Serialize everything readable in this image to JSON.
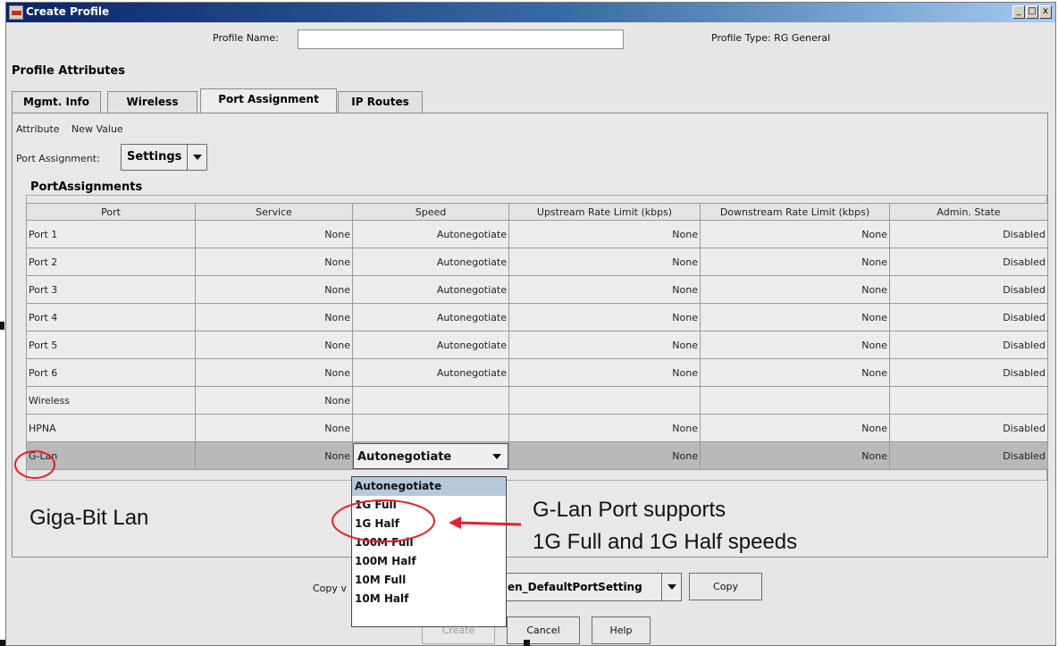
{
  "window": {
    "title": "Create Profile",
    "controls": {
      "minimize": "_",
      "maximize": "□",
      "close": "x"
    }
  },
  "header": {
    "profile_name_label": "Profile Name:",
    "profile_name_value": "",
    "profile_type": "Profile Type: RG General"
  },
  "section_title": "Profile Attributes",
  "tabs": [
    {
      "label": "Mgmt. Info",
      "active": false
    },
    {
      "label": "Wireless",
      "active": false
    },
    {
      "label": "Port Assignment",
      "active": true
    },
    {
      "label": "IP Routes",
      "active": false
    }
  ],
  "attributes": {
    "attribute_label": "Attribute",
    "new_value_label": "New Value",
    "port_assignment_label": "Port Assignment:",
    "port_assignment_value": "Settings"
  },
  "port_assignments": {
    "title": "PortAssignments",
    "columns": [
      "Port",
      "Service",
      "Speed",
      "Upstream Rate Limit (kbps)",
      "Downstream Rate Limit (kbps)",
      "Admin. State"
    ],
    "rows": [
      [
        "Port 1",
        "None",
        "Autonegotiate",
        "None",
        "None",
        "Disabled"
      ],
      [
        "Port 2",
        "None",
        "Autonegotiate",
        "None",
        "None",
        "Disabled"
      ],
      [
        "Port 3",
        "None",
        "Autonegotiate",
        "None",
        "None",
        "Disabled"
      ],
      [
        "Port 4",
        "None",
        "Autonegotiate",
        "None",
        "None",
        "Disabled"
      ],
      [
        "Port 5",
        "None",
        "Autonegotiate",
        "None",
        "None",
        "Disabled"
      ],
      [
        "Port 6",
        "None",
        "Autonegotiate",
        "None",
        "None",
        "Disabled"
      ],
      [
        "Wireless",
        "None",
        "",
        "",
        "",
        ""
      ],
      [
        "HPNA",
        "None",
        "",
        "None",
        "None",
        "Disabled"
      ],
      [
        "G-Lan",
        "None",
        "Autonegotiate",
        "None",
        "None",
        "Disabled"
      ]
    ],
    "selected_row": 8
  },
  "speed_dropdown": {
    "options": [
      "Autonegotiate",
      "1G Full",
      "1G Half",
      "100M Full",
      "100M Half",
      "10M Full",
      "10M Half"
    ],
    "highlighted": "Autonegotiate"
  },
  "annotations": {
    "giga_label": "Giga-Bit Lan",
    "callout_line1": "G-Lan Port supports",
    "callout_line2": "1G Full and 1G Half speeds",
    "highlight_color": "#e8202a"
  },
  "footer": {
    "copy_label": "Copy v",
    "template_value": "en_DefaultPortSetting",
    "copy_button": "Copy",
    "create_button": "Create",
    "cancel_button": "Cancel",
    "help_button": "Help"
  },
  "colors": {
    "titlebar_start": "#0a246a",
    "titlebar_end": "#a6caf0",
    "selected_row": "#b9b9b9",
    "dropdown_highlight": "#b8c8dc"
  }
}
